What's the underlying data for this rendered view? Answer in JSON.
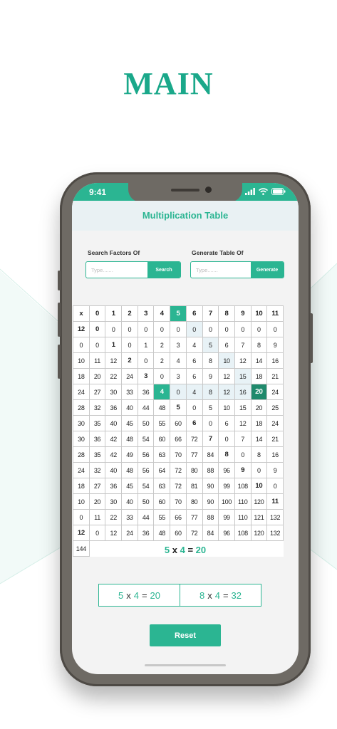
{
  "heading": "MAIN",
  "status_bar": {
    "time": "9:41"
  },
  "app": {
    "title": "Multiplication Table"
  },
  "search_factors": {
    "label": "Search Factors Of",
    "placeholder": "Type.......",
    "button": "Search"
  },
  "generate_table": {
    "label": "Generate Table Of",
    "placeholder": "Type.......",
    "button": "Generate"
  },
  "table": {
    "corner": "x",
    "columns": [
      "0",
      "1",
      "2",
      "3",
      "4",
      "5",
      "6",
      "7",
      "8",
      "9",
      "10",
      "11",
      "12"
    ],
    "rows": [
      {
        "label": "0",
        "values": [
          "0",
          "0",
          "0",
          "0",
          "0",
          "0",
          "0",
          "0",
          "0",
          "0",
          "0",
          "0",
          "0"
        ]
      },
      {
        "label": "1",
        "values": [
          "0",
          "1",
          "2",
          "3",
          "4",
          "5",
          "6",
          "7",
          "8",
          "9",
          "10",
          "11",
          "12"
        ]
      },
      {
        "label": "2",
        "values": [
          "0",
          "2",
          "4",
          "6",
          "8",
          "10",
          "12",
          "14",
          "16",
          "18",
          "20",
          "22",
          "24"
        ]
      },
      {
        "label": "3",
        "values": [
          "0",
          "3",
          "6",
          "9",
          "12",
          "15",
          "18",
          "21",
          "24",
          "27",
          "30",
          "33",
          "36"
        ]
      },
      {
        "label": "4",
        "values": [
          "0",
          "4",
          "8",
          "12",
          "16",
          "20",
          "24",
          "28",
          "32",
          "36",
          "40",
          "44",
          "48"
        ]
      },
      {
        "label": "5",
        "values": [
          "0",
          "5",
          "10",
          "15",
          "20",
          "25",
          "30",
          "35",
          "40",
          "45",
          "50",
          "55",
          "60"
        ]
      },
      {
        "label": "6",
        "values": [
          "0",
          "6",
          "12",
          "18",
          "24",
          "30",
          "36",
          "42",
          "48",
          "54",
          "60",
          "66",
          "72"
        ]
      },
      {
        "label": "7",
        "values": [
          "0",
          "7",
          "14",
          "21",
          "28",
          "35",
          "42",
          "49",
          "56",
          "63",
          "70",
          "77",
          "84"
        ]
      },
      {
        "label": "8",
        "values": [
          "0",
          "8",
          "16",
          "24",
          "32",
          "40",
          "48",
          "56",
          "64",
          "72",
          "80",
          "88",
          "96"
        ]
      },
      {
        "label": "9",
        "values": [
          "0",
          "9",
          "18",
          "27",
          "36",
          "45",
          "54",
          "63",
          "72",
          "81",
          "90",
          "99",
          "108"
        ]
      },
      {
        "label": "10",
        "values": [
          "0",
          "10",
          "20",
          "30",
          "40",
          "50",
          "60",
          "70",
          "80",
          "90",
          "100",
          "110",
          "120"
        ]
      },
      {
        "label": "11",
        "values": [
          "0",
          "11",
          "22",
          "33",
          "44",
          "55",
          "66",
          "77",
          "88",
          "99",
          "110",
          "121",
          "132"
        ]
      },
      {
        "label": "12",
        "values": [
          "0",
          "12",
          "24",
          "36",
          "48",
          "60",
          "72",
          "84",
          "96",
          "108",
          "120",
          "132",
          "144"
        ]
      }
    ],
    "selected_column": "5",
    "selected_row": "4"
  },
  "equation": {
    "a": "5",
    "op": "x",
    "b": "4",
    "eq": "=",
    "result": "20"
  },
  "results": [
    {
      "a": "5",
      "op": "x",
      "b": "4",
      "eq": "=",
      "result": "20"
    },
    {
      "a": "8",
      "op": "x",
      "b": "4",
      "eq": "=",
      "result": "32"
    }
  ],
  "reset_button": "Reset",
  "colors": {
    "accent": "#2bb592",
    "highlight": "#e8f2f6",
    "hit": "#1f8a6c",
    "heading": "#1aa88a"
  }
}
